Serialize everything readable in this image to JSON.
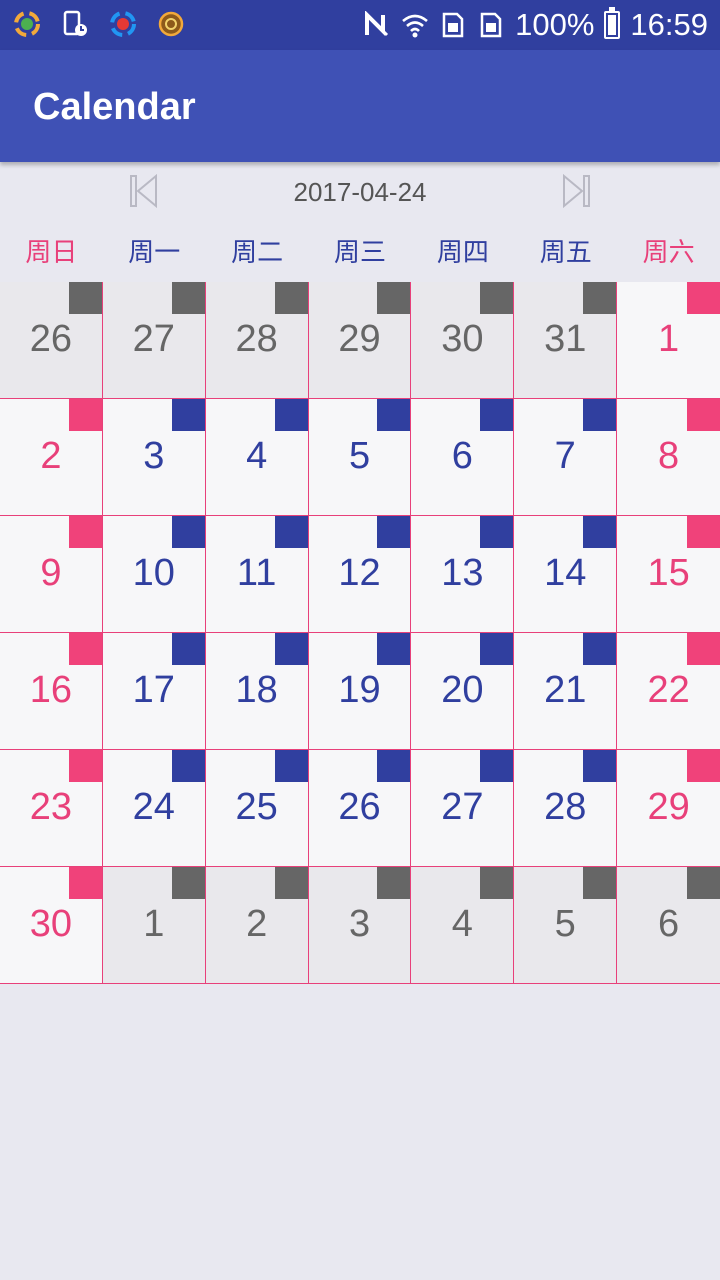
{
  "status_bar": {
    "battery": "100%",
    "time": "16:59",
    "icons": [
      "app-notification-icon",
      "device-clock-icon",
      "app-notification-icon",
      "app-badge-icon",
      "nfc-icon",
      "wifi-icon",
      "sim1-icon",
      "sim2-icon",
      "battery-icon"
    ]
  },
  "app_bar": {
    "title": "Calendar"
  },
  "nav": {
    "date": "2017-04-24",
    "prev_icon": "skip-previous-icon",
    "next_icon": "skip-next-icon"
  },
  "week_days": [
    "周日",
    "周一",
    "周二",
    "周三",
    "周四",
    "周五",
    "周六"
  ],
  "colors": {
    "primary": "#3f51b5",
    "primary_dark": "#303f9f",
    "weekend": "#e8407a",
    "other_month": "#666666"
  },
  "weeks": [
    [
      {
        "d": "26",
        "t": "other"
      },
      {
        "d": "27",
        "t": "other"
      },
      {
        "d": "28",
        "t": "other"
      },
      {
        "d": "29",
        "t": "other"
      },
      {
        "d": "30",
        "t": "other"
      },
      {
        "d": "31",
        "t": "other"
      },
      {
        "d": "1",
        "t": "weekend"
      }
    ],
    [
      {
        "d": "2",
        "t": "weekend"
      },
      {
        "d": "3",
        "t": "weekday"
      },
      {
        "d": "4",
        "t": "weekday"
      },
      {
        "d": "5",
        "t": "weekday"
      },
      {
        "d": "6",
        "t": "weekday"
      },
      {
        "d": "7",
        "t": "weekday"
      },
      {
        "d": "8",
        "t": "weekend"
      }
    ],
    [
      {
        "d": "9",
        "t": "weekend"
      },
      {
        "d": "10",
        "t": "weekday"
      },
      {
        "d": "11",
        "t": "weekday"
      },
      {
        "d": "12",
        "t": "weekday"
      },
      {
        "d": "13",
        "t": "weekday"
      },
      {
        "d": "14",
        "t": "weekday"
      },
      {
        "d": "15",
        "t": "weekend"
      }
    ],
    [
      {
        "d": "16",
        "t": "weekend"
      },
      {
        "d": "17",
        "t": "weekday"
      },
      {
        "d": "18",
        "t": "weekday"
      },
      {
        "d": "19",
        "t": "weekday"
      },
      {
        "d": "20",
        "t": "weekday"
      },
      {
        "d": "21",
        "t": "weekday"
      },
      {
        "d": "22",
        "t": "weekend"
      }
    ],
    [
      {
        "d": "23",
        "t": "weekend"
      },
      {
        "d": "24",
        "t": "weekday"
      },
      {
        "d": "25",
        "t": "weekday"
      },
      {
        "d": "26",
        "t": "weekday"
      },
      {
        "d": "27",
        "t": "weekday"
      },
      {
        "d": "28",
        "t": "weekday"
      },
      {
        "d": "29",
        "t": "weekend"
      }
    ],
    [
      {
        "d": "30",
        "t": "weekend"
      },
      {
        "d": "1",
        "t": "other"
      },
      {
        "d": "2",
        "t": "other"
      },
      {
        "d": "3",
        "t": "other"
      },
      {
        "d": "4",
        "t": "other"
      },
      {
        "d": "5",
        "t": "other"
      },
      {
        "d": "6",
        "t": "other"
      }
    ]
  ]
}
